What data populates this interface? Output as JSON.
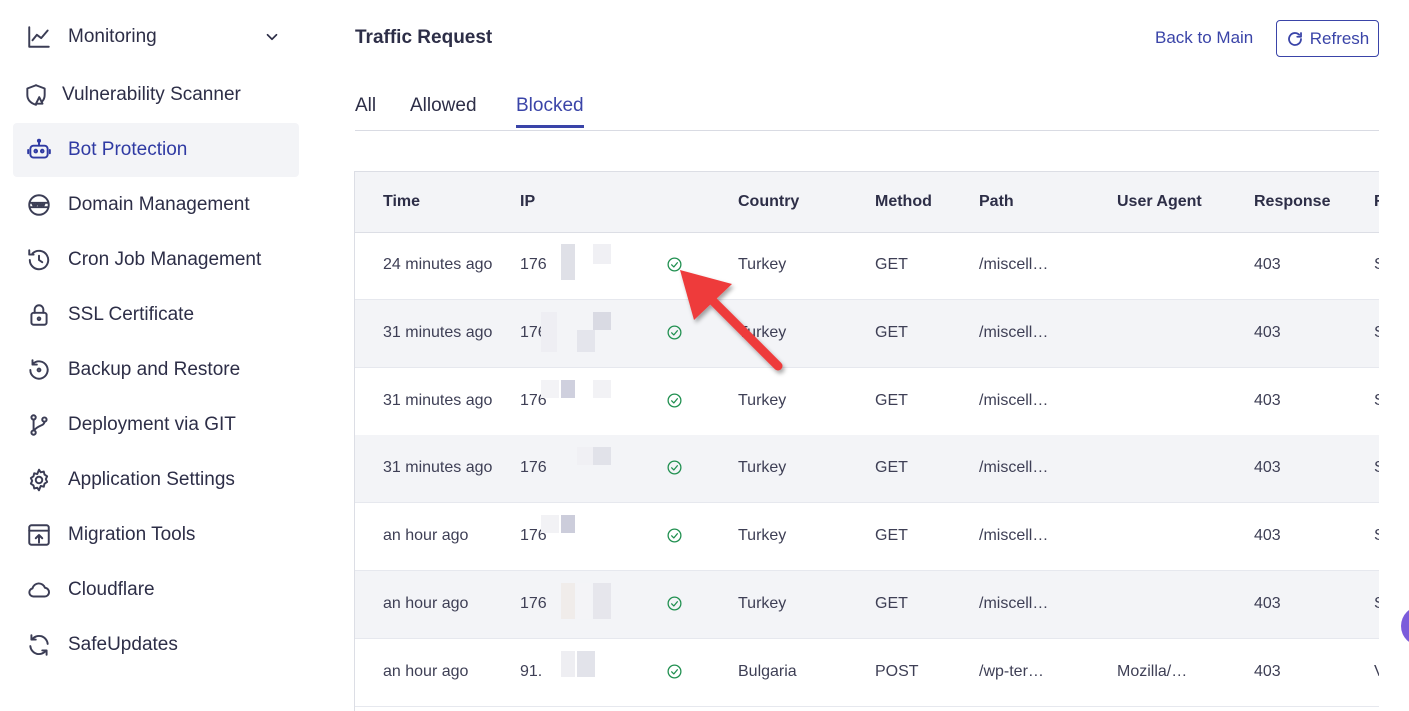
{
  "sidebar": {
    "items": [
      {
        "label": "Monitoring",
        "icon": "chart-line-icon",
        "has_chevron": true
      },
      {
        "label": "Vulnerability Scanner",
        "icon": "shield-warning-icon"
      },
      {
        "label": "Bot Protection",
        "icon": "robot-icon",
        "active": true
      },
      {
        "label": "Domain Management",
        "icon": "www-globe-icon"
      },
      {
        "label": "Cron Job Management",
        "icon": "history-clock-icon"
      },
      {
        "label": "SSL Certificate",
        "icon": "lock-icon"
      },
      {
        "label": "Backup and Restore",
        "icon": "restore-icon"
      },
      {
        "label": "Deployment via GIT",
        "icon": "git-branch-icon"
      },
      {
        "label": "Application Settings",
        "icon": "gear-icon"
      },
      {
        "label": "Migration Tools",
        "icon": "upload-box-icon"
      },
      {
        "label": "Cloudflare",
        "icon": "cloud-icon"
      },
      {
        "label": "SafeUpdates",
        "icon": "refresh-cycle-icon"
      }
    ]
  },
  "header": {
    "title": "Traffic Request",
    "back_link": "Back to Main",
    "refresh_label": "Refresh"
  },
  "tabs": [
    {
      "label": "All"
    },
    {
      "label": "Allowed"
    },
    {
      "label": "Blocked",
      "active": true
    }
  ],
  "table": {
    "columns": [
      "Time",
      "IP",
      "Country",
      "Method",
      "Path",
      "User Agent",
      "Response",
      "R"
    ],
    "rows": [
      {
        "time": "24 minutes ago",
        "ip": "176",
        "country": "Turkey",
        "method": "GET",
        "path": "/miscell…",
        "user_agent": "",
        "response": "403",
        "extra": "S"
      },
      {
        "time": "31 minutes ago",
        "ip": "176",
        "country": "Turkey",
        "method": "GET",
        "path": "/miscell…",
        "user_agent": "",
        "response": "403",
        "extra": "S"
      },
      {
        "time": "31 minutes ago",
        "ip": "176",
        "country": "Turkey",
        "method": "GET",
        "path": "/miscell…",
        "user_agent": "",
        "response": "403",
        "extra": "S"
      },
      {
        "time": "31 minutes ago",
        "ip": "176",
        "country": "Turkey",
        "method": "GET",
        "path": "/miscell…",
        "user_agent": "",
        "response": "403",
        "extra": "S"
      },
      {
        "time": "an hour ago",
        "ip": "176",
        "country": "Turkey",
        "method": "GET",
        "path": "/miscell…",
        "user_agent": "",
        "response": "403",
        "extra": "S"
      },
      {
        "time": "an hour ago",
        "ip": "176",
        "country": "Turkey",
        "method": "GET",
        "path": "/miscell…",
        "user_agent": "",
        "response": "403",
        "extra": "S"
      },
      {
        "time": "an hour ago",
        "ip": "91.",
        "country": "Bulgaria",
        "method": "POST",
        "path": "/wp-ter…",
        "user_agent": "Mozilla/…",
        "response": "403",
        "extra": "V"
      }
    ]
  },
  "colors": {
    "accent": "#3a44a8",
    "check": "#1f8f4f",
    "arrow": "#ee3b3b",
    "row_alt": "#f3f4f7"
  }
}
